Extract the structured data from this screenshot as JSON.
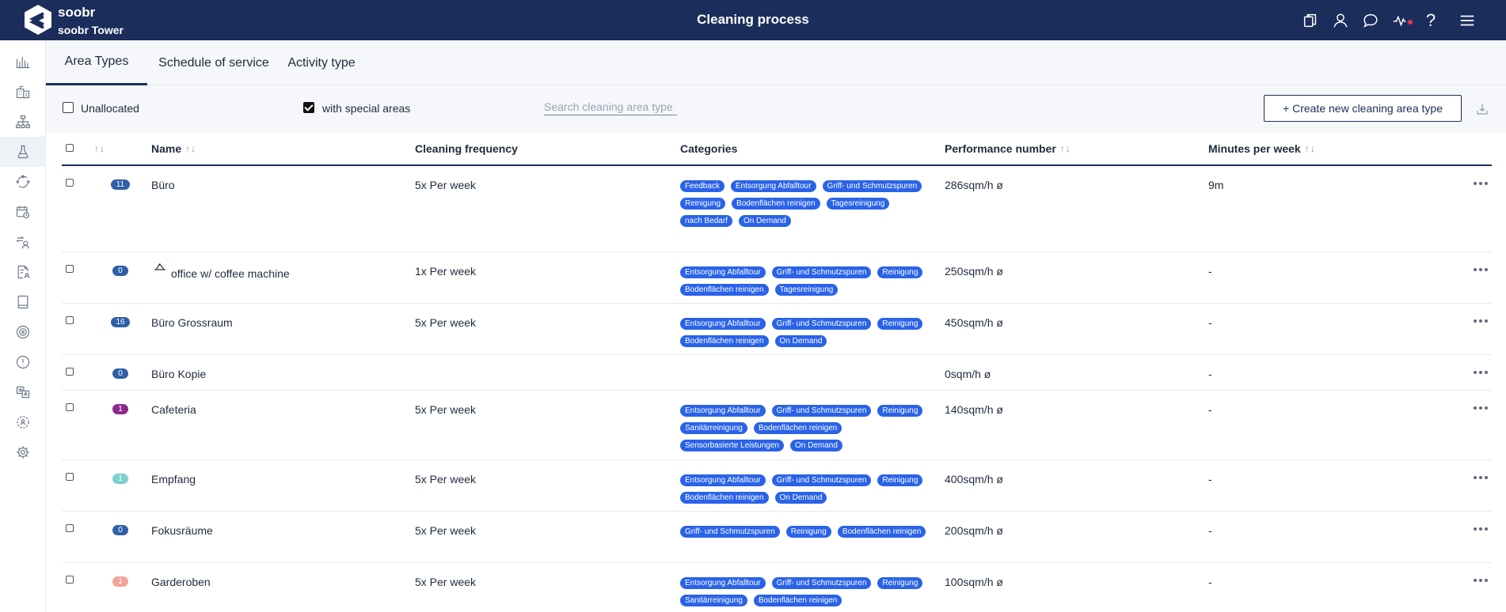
{
  "header": {
    "brand": "soobr",
    "site": "soobr Tower",
    "title": "Cleaning process"
  },
  "tabs": [
    {
      "label": "Area Types",
      "active": true
    },
    {
      "label": "Schedule of service",
      "active": false
    },
    {
      "label": "Activity type",
      "active": false
    }
  ],
  "filters": {
    "unallocated_label": "Unallocated",
    "unallocated_checked": false,
    "special_label": "with special areas",
    "special_checked": true,
    "search_placeholder": "Search cleaning area type",
    "search_value": "",
    "create_label": "+ Create new cleaning area type"
  },
  "table": {
    "columns": {
      "name": "Name",
      "frequency": "Cleaning frequency",
      "categories": "Categories",
      "performance": "Performance number",
      "minutes": "Minutes per week"
    },
    "rows": [
      {
        "count": "11",
        "badge_color": "#2f5fa8",
        "name": "Büro",
        "special": false,
        "frequency": "5x Per week",
        "categories": [
          "Feedback",
          "Entsorgung Abfalltour",
          "Griff- und Schmutzspuren",
          "Reinigung",
          "Bodenflächen reinigen",
          "Tagesreinigung",
          "nach Bedarf",
          "On Demand"
        ],
        "performance": "286sqm/h ø",
        "minutes": "9m"
      },
      {
        "count": "0",
        "badge_color": "#2f5fa8",
        "name": "office w/ coffee machine",
        "special": true,
        "frequency": "1x Per week",
        "categories": [
          "Entsorgung Abfalltour",
          "Griff- und Schmutzspuren",
          "Reinigung",
          "Bodenflächen reinigen",
          "Tagesreinigung"
        ],
        "performance": "250sqm/h ø",
        "minutes": "-"
      },
      {
        "count": "16",
        "badge_color": "#2f5fa8",
        "name": "Büro Grossraum",
        "special": false,
        "frequency": "5x Per week",
        "categories": [
          "Entsorgung Abfalltour",
          "Griff- und Schmutzspuren",
          "Reinigung",
          "Bodenflächen reinigen",
          "On Demand"
        ],
        "performance": "450sqm/h ø",
        "minutes": "-"
      },
      {
        "count": "0",
        "badge_color": "#2f5fa8",
        "name": "Büro Kopie",
        "special": false,
        "frequency": "",
        "categories": [],
        "performance": "0sqm/h ø",
        "minutes": "-"
      },
      {
        "count": "1",
        "badge_color": "#8e2a8e",
        "name": "Cafeteria",
        "special": false,
        "frequency": "5x Per week",
        "categories": [
          "Entsorgung Abfalltour",
          "Griff- und Schmutzspuren",
          "Reinigung",
          "Sanitärreinigung",
          "Bodenflächen reinigen",
          "Sensorbasierte Leistungen",
          "On Demand"
        ],
        "performance": "140sqm/h ø",
        "minutes": "-"
      },
      {
        "count": "1",
        "badge_color": "#7ecfcf",
        "name": "Empfang",
        "special": false,
        "frequency": "5x Per week",
        "categories": [
          "Entsorgung Abfalltour",
          "Griff- und Schmutzspuren",
          "Reinigung",
          "Bodenflächen reinigen",
          "On Demand"
        ],
        "performance": "400sqm/h ø",
        "minutes": "-"
      },
      {
        "count": "0",
        "badge_color": "#2f5fa8",
        "name": "Fokusräume",
        "special": false,
        "frequency": "5x Per week",
        "categories": [
          "Griff- und Schmutzspuren",
          "Reinigung",
          "Bodenflächen reinigen"
        ],
        "performance": "200sqm/h ø",
        "minutes": "-"
      },
      {
        "count": "1",
        "badge_color": "#f2a49a",
        "name": "Garderoben",
        "special": false,
        "frequency": "5x Per week",
        "categories": [
          "Entsorgung Abfalltour",
          "Griff- und Schmutzspuren",
          "Reinigung",
          "Sanitärreinigung",
          "Bodenflächen reinigen"
        ],
        "performance": "100sqm/h ø",
        "minutes": "-"
      }
    ]
  },
  "icons": {
    "top": [
      "copy-icon",
      "user-icon",
      "chat-icon",
      "pulse-icon",
      "help-icon",
      "menu-icon"
    ],
    "sidebar": [
      "bar-chart-icon",
      "building-icon",
      "hierarchy-icon",
      "flask-icon",
      "cycle-icon",
      "calendar-clock-icon",
      "user-swap-icon",
      "document-user-icon",
      "book-icon",
      "target-icon",
      "alert-icon",
      "translate-icon",
      "gear-users-icon",
      "gear-icon"
    ]
  },
  "colors": {
    "header_bg": "#1b2d5a",
    "chip_bg": "#2a63e8",
    "accent": "#1b2d5a"
  }
}
